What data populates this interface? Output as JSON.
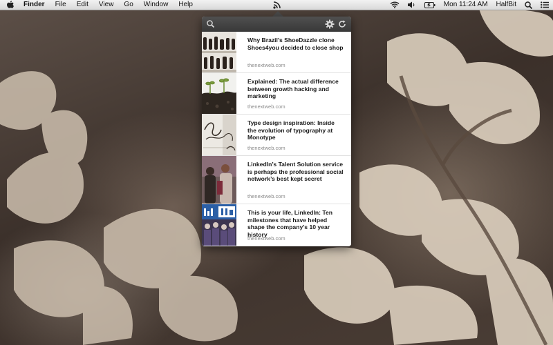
{
  "menubar": {
    "app_name": "Finder",
    "menus": [
      "File",
      "Edit",
      "View",
      "Go",
      "Window",
      "Help"
    ],
    "clock": "Mon 11:24 AM",
    "user": "HalfBit",
    "icons": [
      "apple-icon",
      "rss-icon",
      "wifi-icon",
      "volume-icon",
      "battery-icon",
      "spotlight-icon",
      "notification-center-icon"
    ]
  },
  "popover": {
    "toolbar_icons": [
      "search-icon",
      "gear-icon",
      "refresh-icon"
    ],
    "items": [
      {
        "title": "Why Brazil’s ShoeDazzle clone Shoes4you decided to close shop",
        "source": "thenextweb.com",
        "thumb": "shoes"
      },
      {
        "title": "Explained: The actual difference between growth hacking and marketing",
        "source": "thenextweb.com",
        "thumb": "sprouts"
      },
      {
        "title": "Type design inspiration: Inside the evolution of typography at Monotype",
        "source": "thenextweb.com",
        "thumb": "calligraphy"
      },
      {
        "title": "LinkedIn’s Talent Solution service is perhaps the professional social network’s best kept secret",
        "source": "thenextweb.com",
        "thumb": "people"
      },
      {
        "title": "This is your life, LinkedIn: Ten milestones that have helped shape the company’s 10 year history",
        "source": "thenextweb.com",
        "thumb": "linkedin"
      }
    ]
  }
}
